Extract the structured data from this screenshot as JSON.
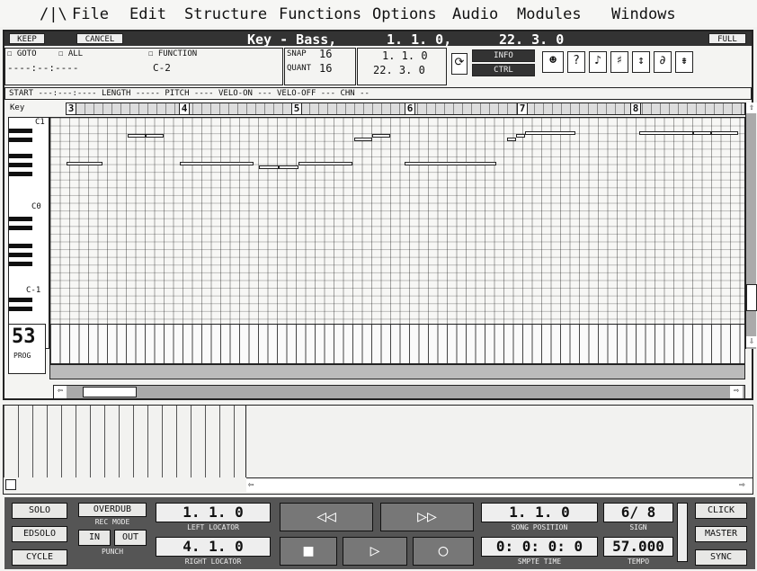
{
  "menu": {
    "logo": "/|\\",
    "items": [
      "File",
      "Edit",
      "Structure",
      "Functions",
      "Options",
      "Audio",
      "Modules",
      "Windows"
    ]
  },
  "editor": {
    "keep": "KEEP",
    "cancel": "CANCEL",
    "title": "Key - Bass,",
    "pos1": "1. 1. 0,",
    "pos2": "22. 3. 0",
    "full": "FULL",
    "goto": "GOTO",
    "all": "ALL",
    "function": "FUNCTION",
    "goto_value": "----:--:----",
    "function_value": "C-2",
    "snap_label": "SNAP",
    "snap_value": "16",
    "quant_label": "QUANT",
    "quant_value": "16",
    "range_start": "1. 1. 0",
    "range_end": "22. 3. 0",
    "info": "INFO",
    "ctrl": "CTRL",
    "column_headers": "START ---:---:---- LENGTH ----- PITCH ---- VELO-ON --- VELO-OFF --- CHN --",
    "key_label": "Key",
    "octave_labels": [
      "C1",
      "C0",
      "C-1"
    ],
    "bar_numbers": [
      "3",
      "4",
      "5",
      "6",
      "7",
      "8"
    ],
    "prog_label": "PROG",
    "prog_value": "53"
  },
  "transport": {
    "solo": "SOLO",
    "edsolo": "EDSOLO",
    "cycle": "CYCLE",
    "overdub": "OVERDUB",
    "rec_mode": "REC MODE",
    "in": "IN",
    "out": "OUT",
    "punch": "PUNCH",
    "left_locator_value": "1. 1. 0",
    "left_locator": "LEFT LOCATOR",
    "right_locator_value": "4. 1. 0",
    "right_locator": "RIGHT LOCATOR",
    "song_position_value": "1. 1. 0",
    "song_position": "SONG POSITION",
    "smpte_value": "0: 0: 0: 0",
    "smpte": "SMPTE TIME",
    "sign_value": "6/ 8",
    "sign": "SIGN",
    "tempo_value": "57.000",
    "tempo": "TEMPO",
    "click": "CLICK",
    "master": "MASTER",
    "sync": "SYNC"
  },
  "icons": [
    "rewind-icon",
    "forward-icon",
    "stop-icon",
    "play-icon",
    "record-icon",
    "ear-icon",
    "question-icon",
    "note-icon"
  ]
}
